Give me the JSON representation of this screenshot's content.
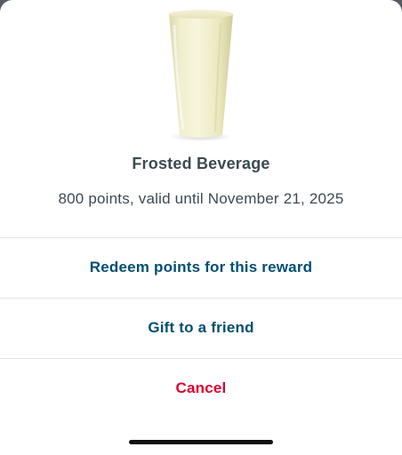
{
  "reward": {
    "title": "Frosted Beverage",
    "subtitle": "800 points, valid until November 21, 2025",
    "image_icon": "frosted-beverage-cup"
  },
  "actions": {
    "redeem_label": "Redeem points for this reward",
    "gift_label": "Gift to a friend",
    "cancel_label": "Cancel"
  },
  "colors": {
    "primary_text": "#004f71",
    "cancel_text": "#dd0031",
    "body_text": "#3d4a52",
    "divider": "#e1e4e6"
  }
}
